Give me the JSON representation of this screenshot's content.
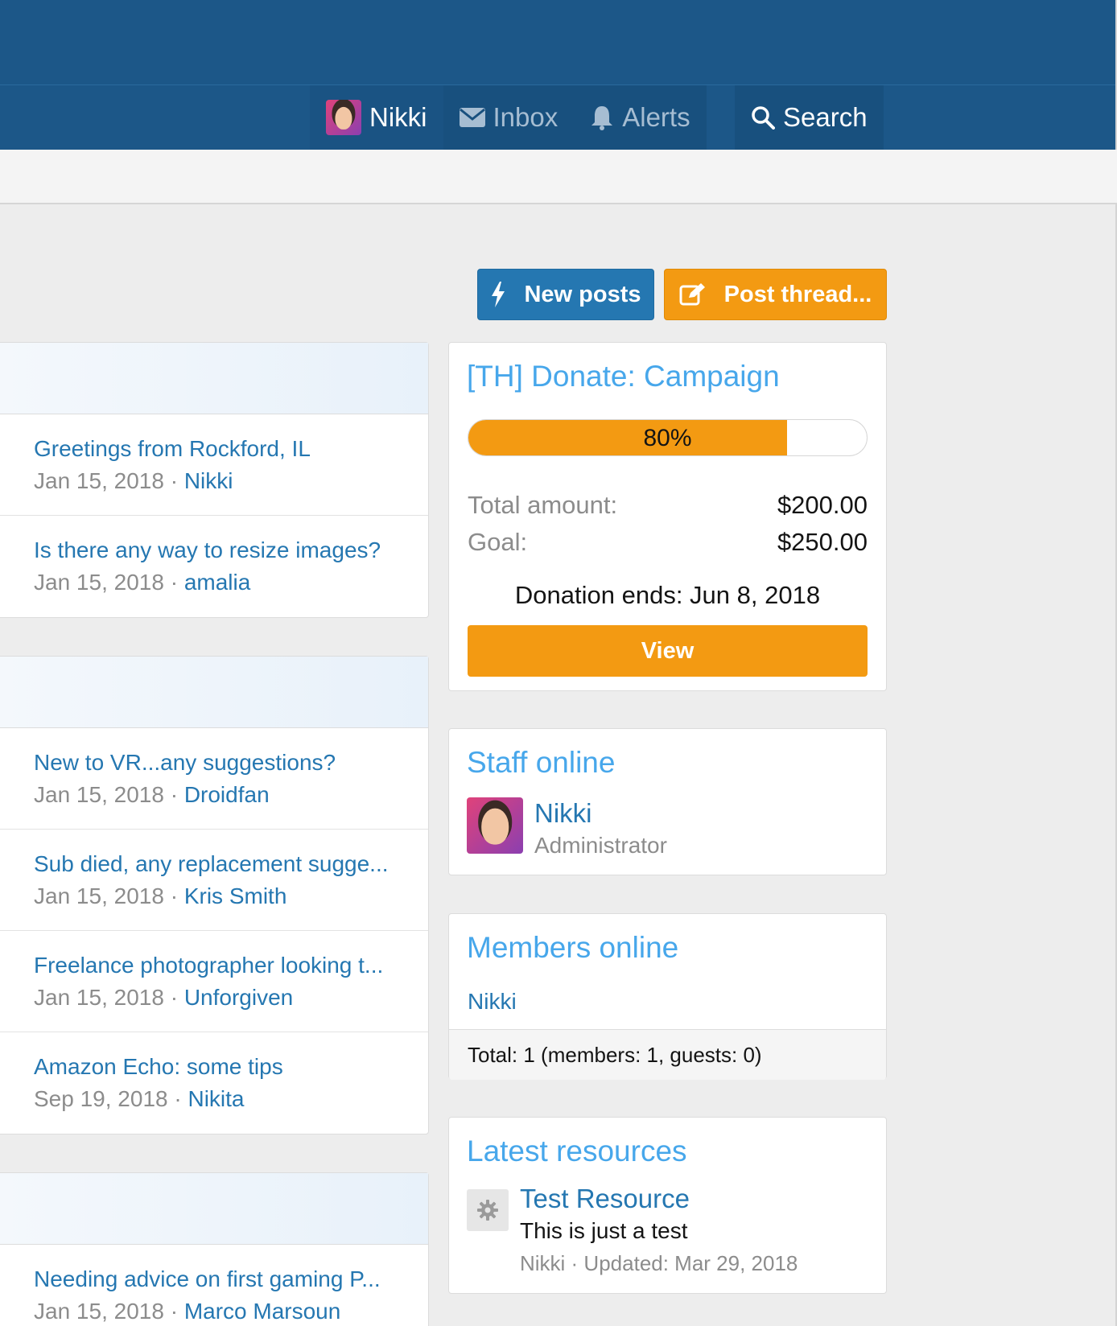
{
  "nav": {
    "user_name": "Nikki",
    "inbox_label": "Inbox",
    "alerts_label": "Alerts",
    "search_label": "Search"
  },
  "actions": {
    "new_posts_label": "New posts",
    "post_thread_label": "Post thread..."
  },
  "thread_blocks": [
    {
      "threads": [
        {
          "title": "Greetings from Rockford, IL",
          "date": "Jan 15, 2018",
          "author": "Nikki"
        },
        {
          "title": "Is there any way to resize images?",
          "date": "Jan 15, 2018",
          "author": "amalia"
        }
      ]
    },
    {
      "threads": [
        {
          "title": "New to VR...any suggestions?",
          "date": "Jan 15, 2018",
          "author": "Droidfan"
        },
        {
          "title": "Sub died, any replacement sugge...",
          "date": "Jan 15, 2018",
          "author": "Kris Smith"
        },
        {
          "title": "Freelance photographer looking t...",
          "date": "Jan 15, 2018",
          "author": "Unforgiven"
        },
        {
          "title": "Amazon Echo: some tips",
          "date": "Sep 19, 2018",
          "author": "Nikita"
        }
      ]
    },
    {
      "threads": [
        {
          "title": "Needing advice on first gaming P...",
          "date": "Jan 15, 2018",
          "author": "Marco Marsoun"
        }
      ]
    }
  ],
  "meta_separator": " · ",
  "donate": {
    "title": "[TH] Donate: Campaign",
    "progress": 0.8,
    "progress_label": "80%",
    "total_label": "Total amount:",
    "total_value": "$200.00",
    "goal_label": "Goal:",
    "goal_value": "$250.00",
    "ends_text": "Donation ends: Jun 8, 2018",
    "view_label": "View"
  },
  "staff_online": {
    "title": "Staff online",
    "name": "Nikki",
    "role": "Administrator"
  },
  "members_online": {
    "title": "Members online",
    "name": "Nikki",
    "total": "Total: 1 (members: 1, guests: 0)"
  },
  "latest_resources": {
    "title": "Latest resources",
    "item_title": "Test Resource",
    "item_desc": "This is just a test",
    "item_meta": "Nikki · Updated: Mar 29, 2018"
  },
  "colors": {
    "header": "#1c5788",
    "accent_blue": "#2577b1",
    "accent_orange": "#f39a12",
    "heading_blue": "#47a7eb"
  }
}
